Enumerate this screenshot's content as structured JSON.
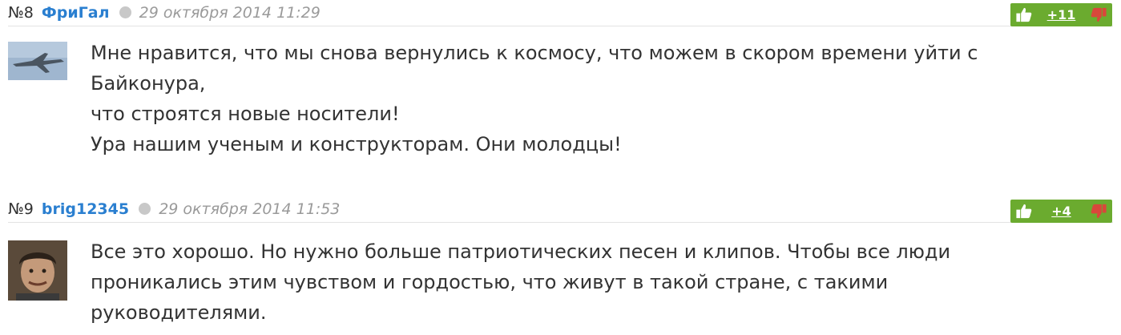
{
  "comments": [
    {
      "number": "№8",
      "author": "ФриГал",
      "date": "29 октября 2014 11:29",
      "score": "+11",
      "lines": [
        "Мне нравится, что мы снова вернулись к космосу, что можем в скором времени уйти с",
        "Байконура,",
        "что строятся новые носители!",
        "Ура нашим ученым и конструкторам. Они молодцы!"
      ]
    },
    {
      "number": "№9",
      "author": "brig12345",
      "date": "29 октября 2014 11:53",
      "score": "+4",
      "lines": [
        "Все это хорошо. Но нужно больше патриотических песен и клипов. Чтобы все люди",
        "проникались этим чувством и гордостью, что живут в такой стране, с такими",
        "руководителями."
      ]
    }
  ],
  "colors": {
    "author_link": "#2a7fd0",
    "vote_bar": "#6bab2f",
    "thumb_down": "#d9473b",
    "date_text": "#9a9a9a"
  },
  "icons": [
    "thumbs-up-icon",
    "thumbs-down-icon",
    "online-status-dot",
    "avatar-jet",
    "avatar-man"
  ]
}
